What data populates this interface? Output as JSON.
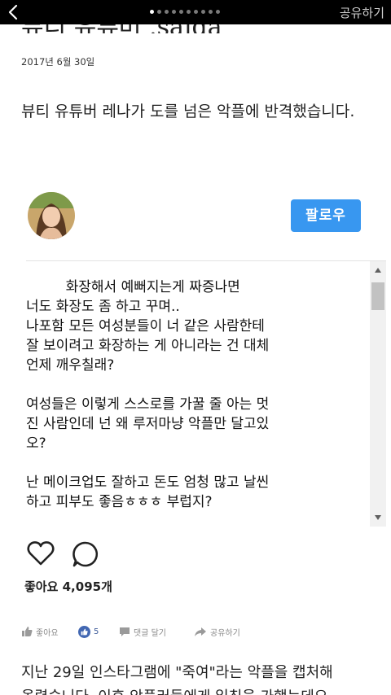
{
  "topbar": {
    "share_label": "공유하기",
    "page_dots_total": 10,
    "page_dots_active": 1
  },
  "article": {
    "title_partial": "뷰티 유튜버 .saida",
    "date": "2017년 6월 30일",
    "lead": "뷰티 유튜버 레나가 도를 넘은 악플에 반격했습니다."
  },
  "embed": {
    "follow_label": "팔로우",
    "post_lines": [
      "         화장해서 예뻐지는게 짜증나면",
      "너도 화장도 좀 하고 꾸며..",
      "나포함 모든 여성분들이 너 같은 사람한테",
      "잘 보이려고 화장하는 게 아니라는 건 대체",
      "언제 깨우칠래?",
      "",
      "여성들은 이렇게 스스로를 가꿀 줄 아는 멋",
      "진 사람인데 넌 왜 루저마냥 악플만 달고있",
      "오?",
      "",
      "난 메이크업도 잘하고 돈도 엄청 많고 날씬",
      "하고 피부도 좋음ㅎㅎㅎ 부럽지?"
    ],
    "likes_label": "좋아요 4,095개"
  },
  "social": {
    "like_label": "좋아요",
    "fb_count": "5",
    "comment_label": "댓글 달기",
    "share_label": "공유하기"
  },
  "body": {
    "line1": "지난 29일 인스타그램에 \"죽여\"라는 악플을 캡처해",
    "line2": "올렸습니다. 이후 악플러들에게 일침을 가했는데요."
  },
  "colors": {
    "follow_button": "#3897f0",
    "facebook_blue": "#4267b2",
    "topbar": "#000000"
  }
}
